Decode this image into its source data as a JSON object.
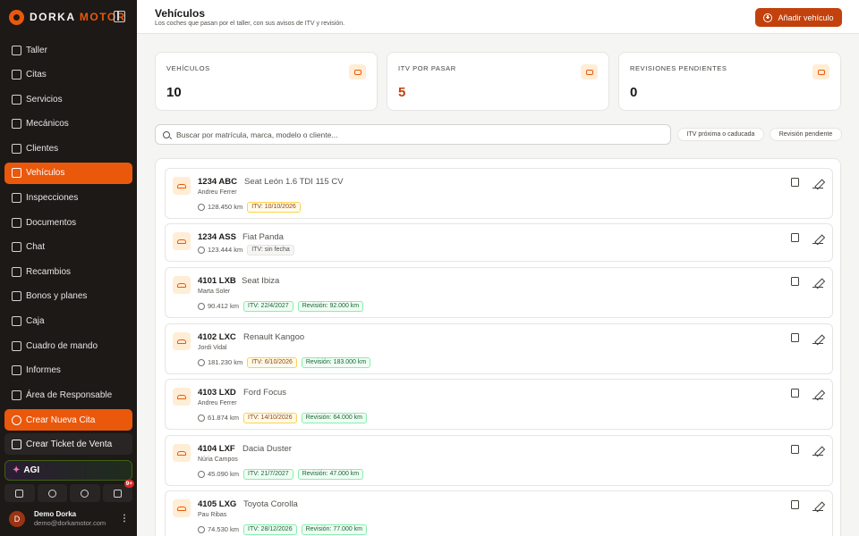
{
  "brand": {
    "name_a": "DORKA",
    "name_b": "MOTOR"
  },
  "sidebar": {
    "items": [
      {
        "label": "Taller",
        "icon": "clipboard-icon",
        "active": false
      },
      {
        "label": "Citas",
        "icon": "checklist-icon",
        "active": false
      },
      {
        "label": "Servicios",
        "icon": "wrench-icon",
        "active": false
      },
      {
        "label": "Mecánicos",
        "icon": "wrench-icon",
        "active": false
      },
      {
        "label": "Clientes",
        "icon": "note-icon",
        "active": false
      },
      {
        "label": "Vehículos",
        "icon": "car-icon",
        "active": true
      },
      {
        "label": "Inspecciones",
        "icon": "clipboard-check-icon",
        "active": false
      },
      {
        "label": "Documentos",
        "icon": "document-edit-icon",
        "active": false
      },
      {
        "label": "Chat",
        "icon": "chat-icon",
        "active": false
      },
      {
        "label": "Recambios",
        "icon": "box-icon",
        "active": false
      },
      {
        "label": "Bonos y planes",
        "icon": "ticket-icon",
        "active": false
      },
      {
        "label": "Caja",
        "icon": "cash-register-icon",
        "active": false
      },
      {
        "label": "Cuadro de mando",
        "icon": "gauge-icon",
        "active": false
      },
      {
        "label": "Informes",
        "icon": "bar-chart-icon",
        "active": false
      },
      {
        "label": "Área de Responsable",
        "icon": "briefcase-icon",
        "active": false
      }
    ],
    "cta_cita": "Crear Nueva Cita",
    "cta_ticket": "Crear Ticket de Venta",
    "agi": "AGI",
    "notifications_badge": "9+",
    "user": {
      "initial": "D",
      "name": "Demo Dorka",
      "email": "demo@dorkamotor.com"
    }
  },
  "header": {
    "title": "Vehículos",
    "subtitle": "Los coches que pasan por el taller, con sus avisos de ITV y revisión.",
    "add_button": "Añadir vehículo"
  },
  "stats": [
    {
      "label": "VEHÍCULOS",
      "value": "10",
      "icon": "car-icon"
    },
    {
      "label": "ITV POR PASAR",
      "value": "5",
      "icon": "calendar-clock-icon"
    },
    {
      "label": "REVISIONES PENDIENTES",
      "value": "0",
      "icon": "wrench-icon"
    }
  ],
  "search": {
    "placeholder": "Buscar por matrícula, marca, modelo o cliente...",
    "value": ""
  },
  "filters": [
    "ITV próxima o caducada",
    "Revisión pendiente"
  ],
  "vehicles": [
    {
      "plate": "1234 ABC",
      "model": "Seat León 1.6 TDI 115 CV",
      "owner": "Andreu Ferrer",
      "km": "128.450 km",
      "itv": "ITV: 10/10/2026",
      "itv_status": "amber",
      "revision": ""
    },
    {
      "plate": "1234 ASS",
      "model": "Fiat Panda",
      "owner": "",
      "km": "123.444 km",
      "itv": "ITV: sin fecha",
      "itv_status": "gray",
      "revision": ""
    },
    {
      "plate": "4101 LXB",
      "model": "Seat Ibiza",
      "owner": "Marta Soler",
      "km": "90.412 km",
      "itv": "ITV: 22/4/2027",
      "itv_status": "green",
      "revision": "Revisión: 92.000 km"
    },
    {
      "plate": "4102 LXC",
      "model": "Renault Kangoo",
      "owner": "Jordi Vidal",
      "km": "181.230 km",
      "itv": "ITV: 6/10/2026",
      "itv_status": "amber",
      "revision": "Revisión: 183.000 km"
    },
    {
      "plate": "4103 LXD",
      "model": "Ford Focus",
      "owner": "Andreu Ferrer",
      "km": "61.874 km",
      "itv": "ITV: 14/10/2026",
      "itv_status": "amber",
      "revision": "Revisión: 64.000 km"
    },
    {
      "plate": "4104 LXF",
      "model": "Dacia Duster",
      "owner": "Núria Campos",
      "km": "45.090 km",
      "itv": "ITV: 21/7/2027",
      "itv_status": "green",
      "revision": "Revisión: 47.000 km"
    },
    {
      "plate": "4105 LXG",
      "model": "Toyota Corolla",
      "owner": "Pau Ribas",
      "km": "74.530 km",
      "itv": "ITV: 28/12/2026",
      "itv_status": "green",
      "revision": "Revisión: 77.000 km"
    }
  ]
}
